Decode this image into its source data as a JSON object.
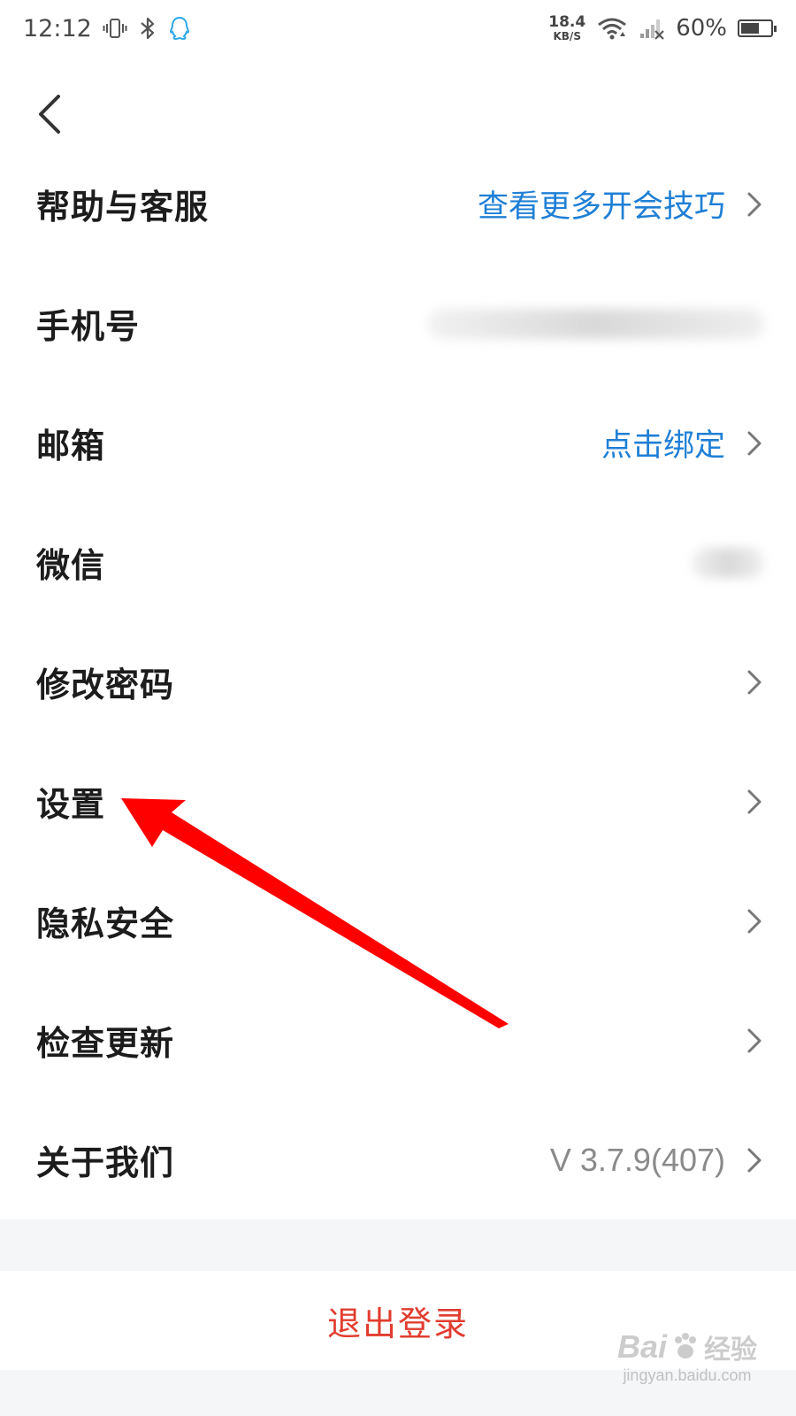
{
  "status_bar": {
    "time": "12:12",
    "net_speed": "18.4",
    "net_speed_unit": "KB/S",
    "battery": "60%",
    "icons": [
      "vibrate-icon",
      "bluetooth-icon",
      "qq-icon",
      "wifi-icon",
      "signal-icon",
      "battery-icon"
    ]
  },
  "nav": {
    "back_icon": "chevron-left-icon"
  },
  "menu": [
    {
      "id": "help",
      "label": "帮助与客服",
      "value": "查看更多开会技巧",
      "value_style": "link",
      "chevron": true
    },
    {
      "id": "phone",
      "label": "手机号",
      "value": null,
      "value_style": "blurred",
      "chevron": false
    },
    {
      "id": "email",
      "label": "邮箱",
      "value": "点击绑定",
      "value_style": "link",
      "chevron": true
    },
    {
      "id": "wechat",
      "label": "微信",
      "value": null,
      "value_style": "blurred",
      "chevron": false
    },
    {
      "id": "password",
      "label": "修改密码",
      "value": "",
      "chevron": true
    },
    {
      "id": "settings",
      "label": "设置",
      "value": "",
      "chevron": true
    },
    {
      "id": "privacy",
      "label": "隐私安全",
      "value": "",
      "chevron": true
    },
    {
      "id": "update",
      "label": "检查更新",
      "value": "",
      "chevron": true
    },
    {
      "id": "about",
      "label": "关于我们",
      "value": "V 3.7.9(407)",
      "value_style": "muted",
      "chevron": true
    }
  ],
  "logout": {
    "label": "退出登录"
  },
  "colors": {
    "link": "#1f7fd6",
    "logout": "#e23c2f",
    "annotation_arrow": "#ff0000",
    "band": "#f5f6f8"
  },
  "annotation": {
    "type": "red-arrow",
    "points_to": "settings"
  },
  "watermark": {
    "brand": "Bai",
    "brand_suffix": "经验",
    "url": "jingyan.baidu.com"
  }
}
